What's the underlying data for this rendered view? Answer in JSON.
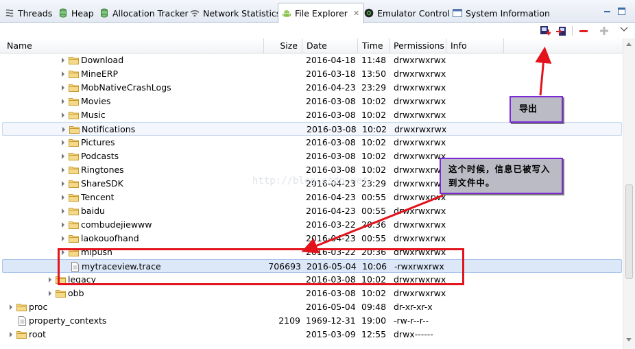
{
  "tabs": [
    {
      "label": "Threads",
      "icon": "threads-icon"
    },
    {
      "label": "Heap",
      "icon": "heap-cylinder-icon"
    },
    {
      "label": "Allocation Tracker",
      "icon": "allocation-cylinder-icon"
    },
    {
      "label": "Network Statistics",
      "icon": "wifi-icon"
    },
    {
      "label": "File Explorer",
      "icon": "android-icon",
      "active": true
    },
    {
      "label": "Emulator Control",
      "icon": "emulator-icon"
    },
    {
      "label": "System Information",
      "icon": "window-icon"
    }
  ],
  "toolbar": {
    "buttons": [
      "pull-file-icon",
      "push-file-icon",
      "delete-icon",
      "new-folder-icon",
      "view-menu-icon"
    ]
  },
  "columns": {
    "name": "Name",
    "size": "Size",
    "date": "Date",
    "time": "Time",
    "permissions": "Permissions",
    "info": "Info"
  },
  "rows": [
    {
      "name": "Download",
      "size": "",
      "date": "2016-04-18",
      "time": "11:48",
      "perm": "drwxrwxrwx",
      "indent": 4,
      "type": "folder"
    },
    {
      "name": "MineERP",
      "size": "",
      "date": "2016-03-18",
      "time": "13:50",
      "perm": "drwxrwxrwx",
      "indent": 4,
      "type": "folder"
    },
    {
      "name": "MobNativeCrashLogs",
      "size": "",
      "date": "2016-04-23",
      "time": "23:29",
      "perm": "drwxrwxrwx",
      "indent": 4,
      "type": "folder"
    },
    {
      "name": "Movies",
      "size": "",
      "date": "2016-03-08",
      "time": "10:02",
      "perm": "drwxrwxrwx",
      "indent": 4,
      "type": "folder"
    },
    {
      "name": "Music",
      "size": "",
      "date": "2016-03-08",
      "time": "10:02",
      "perm": "drwxrwxrwx",
      "indent": 4,
      "type": "folder"
    },
    {
      "name": "Notifications",
      "size": "",
      "date": "2016-03-08",
      "time": "10:02",
      "perm": "drwxrwxrwx",
      "indent": 4,
      "type": "folder",
      "state": "hover"
    },
    {
      "name": "Pictures",
      "size": "",
      "date": "2016-03-08",
      "time": "10:02",
      "perm": "drwxrwxrwx",
      "indent": 4,
      "type": "folder"
    },
    {
      "name": "Podcasts",
      "size": "",
      "date": "2016-03-08",
      "time": "10:02",
      "perm": "drwxrwxrwx",
      "indent": 4,
      "type": "folder"
    },
    {
      "name": "Ringtones",
      "size": "",
      "date": "2016-03-08",
      "time": "10:02",
      "perm": "drwxrwxrwx",
      "indent": 4,
      "type": "folder"
    },
    {
      "name": "ShareSDK",
      "size": "",
      "date": "2016-04-23",
      "time": "23:29",
      "perm": "drwxrwxrwx",
      "indent": 4,
      "type": "folder"
    },
    {
      "name": "Tencent",
      "size": "",
      "date": "2016-04-23",
      "time": "00:55",
      "perm": "drwxrwxrwx",
      "indent": 4,
      "type": "folder"
    },
    {
      "name": "baidu",
      "size": "",
      "date": "2016-04-23",
      "time": "00:55",
      "perm": "drwxrwxrwx",
      "indent": 4,
      "type": "folder"
    },
    {
      "name": "combudejiewww",
      "size": "",
      "date": "2016-03-22",
      "time": "20:36",
      "perm": "drwxrwxrwx",
      "indent": 4,
      "type": "folder"
    },
    {
      "name": "laokouofhand",
      "size": "",
      "date": "2016-04-23",
      "time": "00:55",
      "perm": "drwxrwxrwx",
      "indent": 4,
      "type": "folder"
    },
    {
      "name": "mipush",
      "size": "",
      "date": "2016-03-22",
      "time": "20:36",
      "perm": "drwxrwxrwx",
      "indent": 4,
      "type": "folder"
    },
    {
      "name": "mytraceview.trace",
      "size": "706693",
      "date": "2016-05-04",
      "time": "10:06",
      "perm": "-rwxrwxrwx",
      "indent": 4,
      "type": "file",
      "state": "selected"
    },
    {
      "name": "legacy",
      "size": "",
      "date": "2016-03-08",
      "time": "10:02",
      "perm": "drwxrwxrwx",
      "indent": 3,
      "type": "folder"
    },
    {
      "name": "obb",
      "size": "",
      "date": "2016-03-08",
      "time": "10:02",
      "perm": "drwxrwxrwx",
      "indent": 3,
      "type": "folder"
    },
    {
      "name": "proc",
      "size": "",
      "date": "2016-05-04",
      "time": "09:48",
      "perm": "dr-xr-xr-x",
      "indent": 0,
      "type": "folder"
    },
    {
      "name": "property_contexts",
      "size": "2109",
      "date": "1969-12-31",
      "time": "19:00",
      "perm": "-rw-r--r--",
      "indent": 0,
      "type": "file"
    },
    {
      "name": "root",
      "size": "",
      "date": "2015-03-09",
      "time": "12:55",
      "perm": "drwx------",
      "indent": 0,
      "type": "folder"
    }
  ],
  "annotations": {
    "export_label": "导出",
    "written_label": "这个时候，信息已被写入到文件中。",
    "watermark": "http://blog.csdn.net/",
    "arrow_color": "#e3121b",
    "box_border": "#7b2ad6"
  }
}
